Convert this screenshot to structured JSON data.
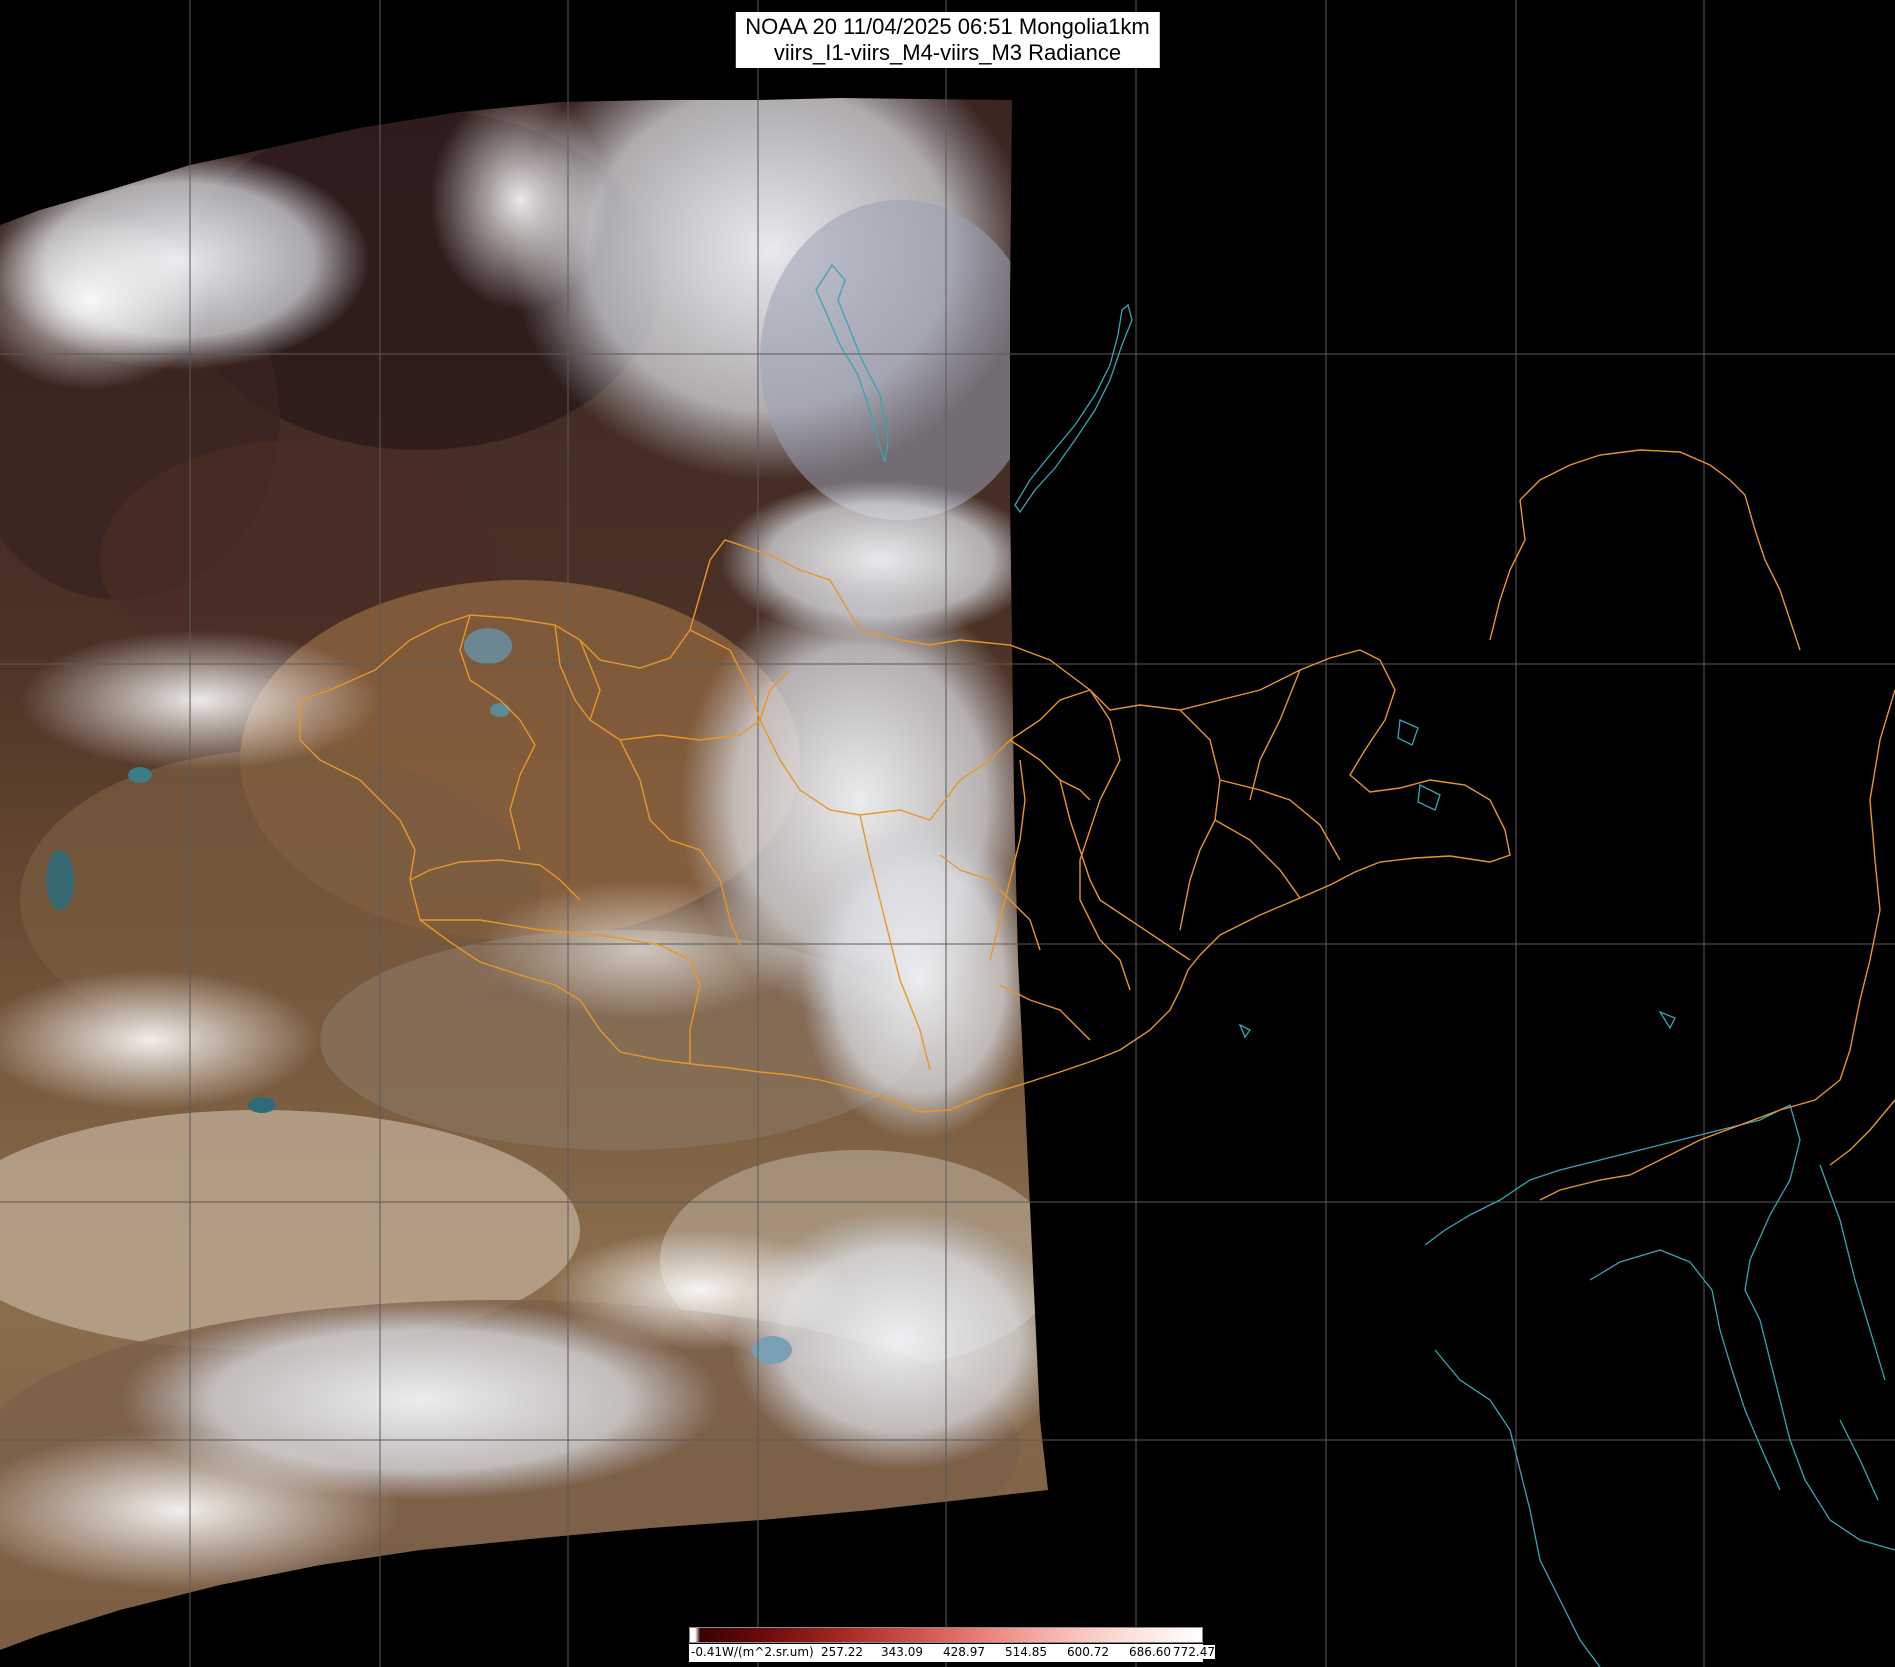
{
  "title": {
    "line1": "NOAA 20 11/04/2025 06:51 Mongolia1km",
    "line2": "viirs_I1-viirs_M4-viirs_M3 Radiance"
  },
  "colorbar": {
    "labels": [
      "-0.41W/(m^2.sr.um)",
      "257.22",
      "343.09",
      "428.97",
      "514.85",
      "600.72",
      "686.60",
      "772.47"
    ]
  },
  "colors": {
    "background": "#000000",
    "boundary": "#e8962a",
    "coastline": "#3aa4b4",
    "graticule": "#5a5a5a"
  }
}
